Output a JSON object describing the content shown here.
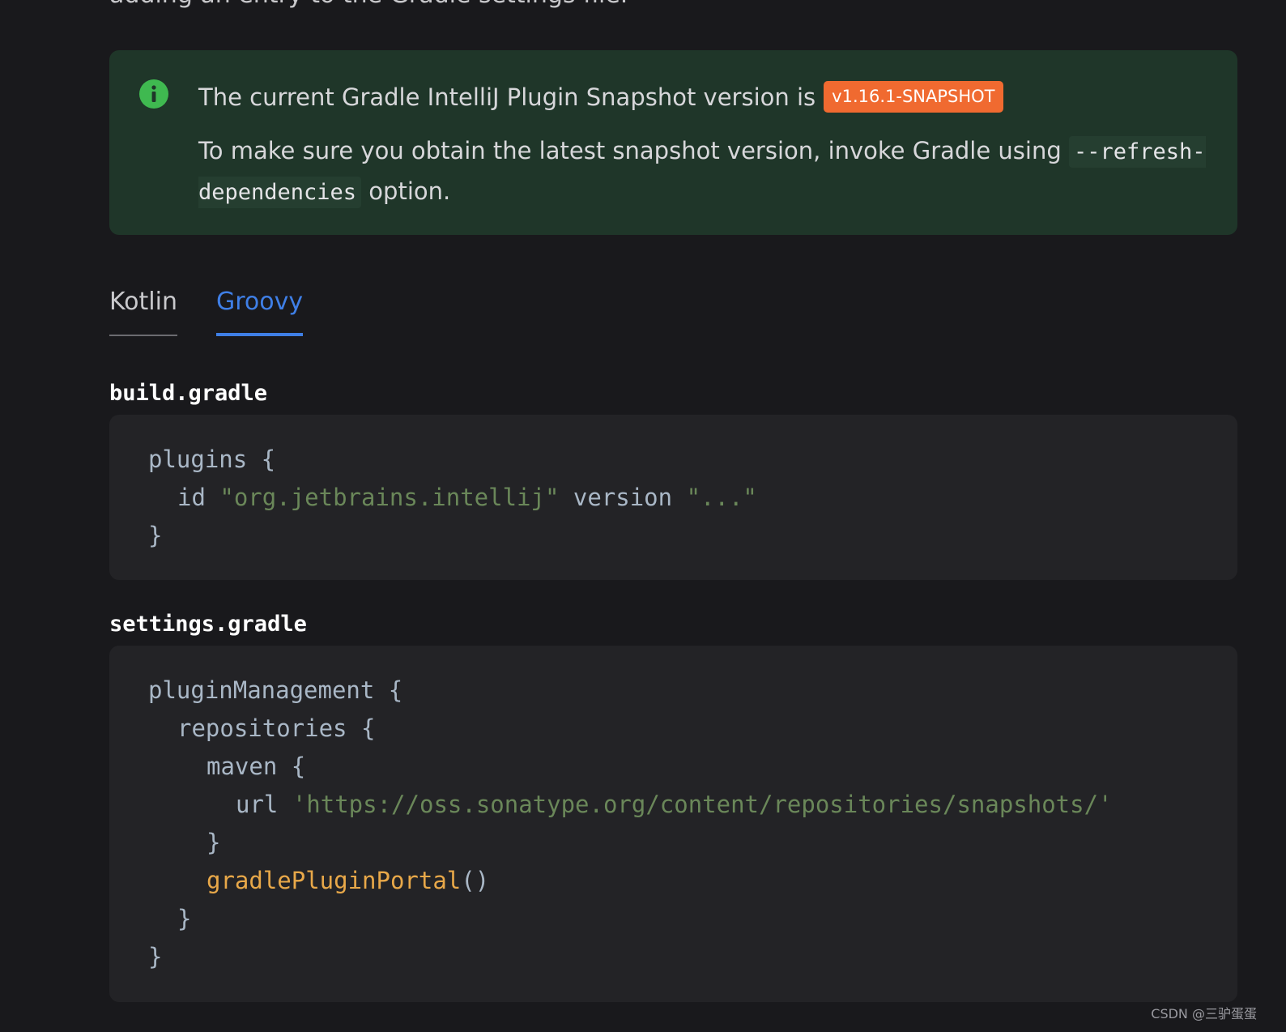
{
  "top_text": "adding an entry to the Gradle settings file.",
  "note": {
    "line1": "The current Gradle IntelliJ Plugin Snapshot version is",
    "version_badge": "v1.16.1-SNAPSHOT",
    "line2_before": "To make sure you obtain the latest snapshot version, invoke Gradle using ",
    "line2_code": "--refresh-dependencies",
    "line2_after": " option."
  },
  "tabs": [
    {
      "label": "Kotlin",
      "active": false
    },
    {
      "label": "Groovy",
      "active": true
    }
  ],
  "build_file": {
    "title": "build.gradle",
    "lines": [
      {
        "indent": 0,
        "code": "plugins {"
      },
      {
        "indent": 1,
        "code": "id ",
        "string": "\"org.jetbrains.intellij\"",
        "code2": " version ",
        "string2": "\"...\""
      },
      {
        "indent": 0,
        "code": "}"
      }
    ]
  },
  "settings_file": {
    "title": "settings.gradle",
    "lines": [
      {
        "indent": 0,
        "code": "pluginManagement {"
      },
      {
        "indent": 1,
        "code": "repositories {"
      },
      {
        "indent": 2,
        "code": "maven {"
      },
      {
        "indent": 3,
        "code": "url ",
        "string": "'https://oss.sonatype.org/content/repositories/snapshots/'"
      },
      {
        "indent": 2,
        "code": "}"
      },
      {
        "indent": 2,
        "fn": "gradlePluginPortal",
        "code": "()"
      },
      {
        "indent": 1,
        "code": "}"
      },
      {
        "indent": 0,
        "code": "}"
      }
    ]
  },
  "watermark": "CSDN @三驴蛋蛋",
  "colors": {
    "background": "#19191c",
    "note_bg": "#1f3629",
    "badge_bg": "#f06a30",
    "info_icon": "#3fb950",
    "tab_active": "#3f7fe6",
    "code_bg": "#232326",
    "code_string": "#6a8759",
    "code_function": "#e8a849"
  },
  "icons": {
    "note_icon": "info-circle-icon"
  }
}
